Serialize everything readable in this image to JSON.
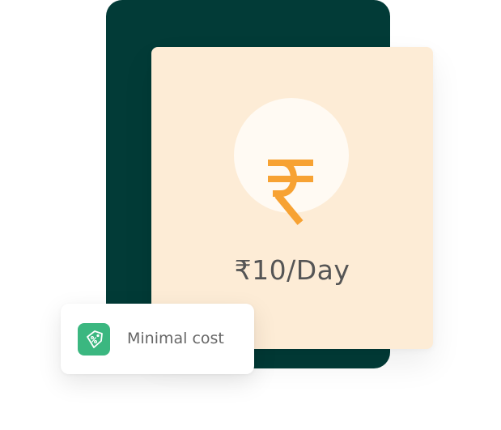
{
  "pricing": {
    "price_label": "₹10/Day",
    "currency_icon": "rupee-icon",
    "accent_color": "#f7a233"
  },
  "feature_badge": {
    "label": "Minimal cost",
    "icon": "discount-tag-icon",
    "icon_color": "#3bb780"
  },
  "colors": {
    "back_card": "#023b37",
    "front_card": "#fdecd6"
  }
}
